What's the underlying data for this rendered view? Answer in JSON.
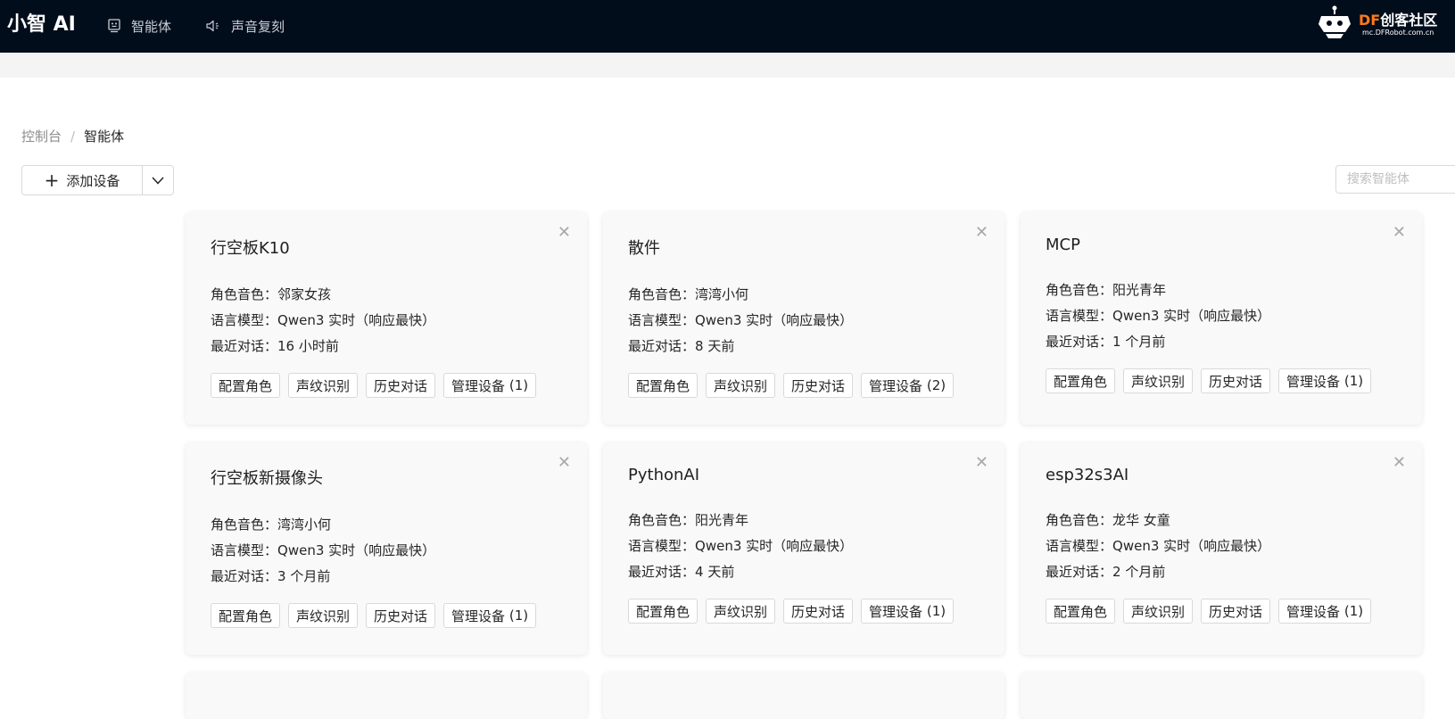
{
  "header": {
    "brand": "小智 AI",
    "nav": [
      {
        "label": "智能体",
        "icon": "robot-icon"
      },
      {
        "label": "声音复刻",
        "icon": "speaker-icon"
      }
    ],
    "logo": {
      "df": "DF",
      "cn": "创客社区",
      "url": "mc.DFRobot.com.cn"
    }
  },
  "breadcrumb": {
    "root": "控制台",
    "separator": "/",
    "current": "智能体"
  },
  "toolbar": {
    "add_label": "添加设备",
    "search_placeholder": "搜索智能体"
  },
  "labels": {
    "role_voice": "角色音色：",
    "llm": "语言模型：",
    "recent": "最近对话："
  },
  "card_actions": {
    "configure": "配置角色",
    "voiceprint": "声纹识别",
    "history": "历史对话",
    "manage": "管理设备"
  },
  "cards": [
    {
      "title": "行空板K10",
      "voice": "邻家女孩",
      "model": "Qwen3 实时（响应最快）",
      "recent": "16 小时前",
      "devices": "(1)"
    },
    {
      "title": "散件",
      "voice": "湾湾小何",
      "model": "Qwen3 实时（响应最快）",
      "recent": "8 天前",
      "devices": "(2)"
    },
    {
      "title": "MCP",
      "voice": "阳光青年",
      "model": "Qwen3 实时（响应最快）",
      "recent": "1 个月前",
      "devices": "(1)"
    },
    {
      "title": "行空板新摄像头",
      "voice": "湾湾小何",
      "model": "Qwen3 实时（响应最快）",
      "recent": "3 个月前",
      "devices": "(1)"
    },
    {
      "title": "PythonAI",
      "voice": "阳光青年",
      "model": "Qwen3 实时（响应最快）",
      "recent": "4 天前",
      "devices": "(1)"
    },
    {
      "title": "esp32s3AI",
      "voice": "龙华 女童",
      "model": "Qwen3 实时（响应最快）",
      "recent": "2 个月前",
      "devices": "(1)"
    }
  ],
  "colors": {
    "header_bg": "#020d1c",
    "card_bg": "#f9f9f9",
    "logo_accent": "#ff7a1a"
  }
}
